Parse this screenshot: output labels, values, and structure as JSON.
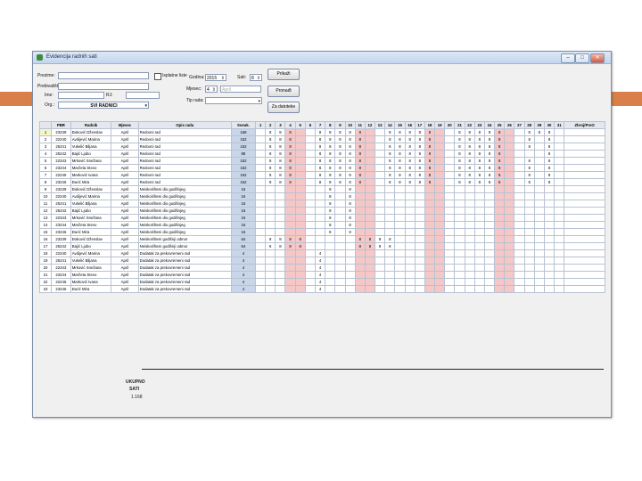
{
  "window": {
    "title": "Evidencija radnih sati",
    "min_label": "–",
    "max_label": "□",
    "close_label": "✕"
  },
  "filters": {
    "prezime_label": "Prezime:",
    "ime_label": "Ime:",
    "prebivaliste_label": "Prebivalište:",
    "radna_jedinica_label": "RJ:",
    "org_label": "Org.:",
    "org_value": "SVI RADNICI",
    "checkbox_label": "Isplatne liste",
    "godina_label": "Godina:",
    "godina_value": "2015",
    "mjesec_label": "Mjesec:",
    "mjesec_value": "4",
    "mjesec_name": "April",
    "sati_label": "Sati:",
    "sati_value": "8",
    "tip_label": "Tip rada:",
    "prikazi_label": "Prikaži",
    "pronadi_label": "Pronađi",
    "za_datoteke_label": "Za datoteke"
  },
  "grid": {
    "headers": [
      "PBR",
      "Radnik",
      "Mjesec",
      "Opis rada",
      "Sveuk.",
      "1",
      "2",
      "3",
      "4",
      "5",
      "6",
      "7",
      "8",
      "9",
      "10",
      "11",
      "12",
      "13",
      "14",
      "15",
      "16",
      "17",
      "18",
      "19",
      "20",
      "21",
      "22",
      "23",
      "24",
      "25",
      "26",
      "27",
      "28",
      "29",
      "30",
      "31",
      "Zbroj/PreO"
    ],
    "weekend_days": [
      4,
      5,
      11,
      12,
      18,
      19,
      25,
      26
    ],
    "rows": [
      {
        "num": "1",
        "pbr": "23239",
        "name": "Đoković Dženslav",
        "month": "April",
        "desc": "Redovni rad",
        "hours": "168",
        "days": [
          "",
          "8",
          "8",
          "8",
          "",
          "",
          "8",
          "8",
          "8",
          "8",
          "8",
          "",
          "",
          "8",
          "8",
          "8",
          "8",
          "8",
          "",
          "",
          "8",
          "8",
          "8",
          "8",
          "8",
          "",
          "",
          "8",
          "8",
          "8",
          ""
        ]
      },
      {
        "num": "2",
        "pbr": "22240",
        "name": "Avdijević Marina",
        "month": "April",
        "desc": "Redovni rad",
        "hours": "152",
        "days": [
          "",
          "8",
          "8",
          "8",
          "",
          "",
          "8",
          "8",
          "8",
          "8",
          "8",
          "",
          "",
          "8",
          "8",
          "8",
          "8",
          "8",
          "",
          "",
          "8",
          "8",
          "8",
          "8",
          "8",
          "",
          "",
          "8",
          "",
          "8",
          ""
        ]
      },
      {
        "num": "3",
        "pbr": "25241",
        "name": "Vukelić Biljana",
        "month": "April",
        "desc": "Redovni rad",
        "hours": "152",
        "days": [
          "",
          "8",
          "8",
          "8",
          "",
          "",
          "8",
          "8",
          "8",
          "8",
          "8",
          "",
          "",
          "8",
          "8",
          "8",
          "8",
          "8",
          "",
          "",
          "8",
          "8",
          "8",
          "8",
          "8",
          "",
          "",
          "8",
          "",
          "8",
          ""
        ]
      },
      {
        "num": "4",
        "pbr": "25242",
        "name": "Bajić Ljubo",
        "month": "April",
        "desc": "Redovni rad",
        "hours": "88",
        "days": [
          "",
          "8",
          "8",
          "8",
          "",
          "",
          "8",
          "8",
          "8",
          "8",
          "8",
          "",
          "",
          "8",
          "8",
          "8",
          "8",
          "8",
          "",
          "",
          "8",
          "8",
          "8",
          "8",
          "8",
          "",
          "",
          "",
          "",
          "8",
          ""
        ]
      },
      {
        "num": "5",
        "pbr": "22343",
        "name": "Mrković Snežana",
        "month": "April",
        "desc": "Redovni rad",
        "hours": "152",
        "days": [
          "",
          "8",
          "8",
          "8",
          "",
          "",
          "8",
          "8",
          "8",
          "8",
          "8",
          "",
          "",
          "8",
          "8",
          "8",
          "8",
          "8",
          "",
          "",
          "8",
          "8",
          "8",
          "8",
          "8",
          "",
          "",
          "8",
          "",
          "8",
          ""
        ]
      },
      {
        "num": "6",
        "pbr": "23244",
        "name": "Marčeta Stevo",
        "month": "April",
        "desc": "Redovni rad",
        "hours": "152",
        "days": [
          "",
          "8",
          "8",
          "8",
          "",
          "",
          "8",
          "8",
          "8",
          "8",
          "8",
          "",
          "",
          "8",
          "8",
          "8",
          "8",
          "8",
          "",
          "",
          "8",
          "8",
          "8",
          "8",
          "8",
          "",
          "",
          "8",
          "",
          "8",
          ""
        ]
      },
      {
        "num": "7",
        "pbr": "22245",
        "name": "Marković Ivana",
        "month": "April",
        "desc": "Redovni rad",
        "hours": "152",
        "days": [
          "",
          "8",
          "8",
          "8",
          "",
          "",
          "8",
          "8",
          "8",
          "8",
          "8",
          "",
          "",
          "8",
          "8",
          "8",
          "8",
          "8",
          "",
          "",
          "8",
          "8",
          "8",
          "8",
          "8",
          "",
          "",
          "8",
          "",
          "8",
          ""
        ]
      },
      {
        "num": "8",
        "pbr": "23246",
        "name": "Đurić Mira",
        "month": "April",
        "desc": "Redovni rad",
        "hours": "152",
        "days": [
          "",
          "8",
          "8",
          "8",
          "",
          "",
          "8",
          "8",
          "8",
          "8",
          "8",
          "",
          "",
          "8",
          "8",
          "8",
          "8",
          "8",
          "",
          "",
          "8",
          "8",
          "8",
          "8",
          "8",
          "",
          "",
          "8",
          "",
          "8",
          ""
        ]
      },
      {
        "num": "9",
        "pbr": "23239",
        "name": "Đoković Dženslav",
        "month": "April",
        "desc": "Neiskorišteni dio godišnjeg",
        "hours": "16",
        "days": [
          "",
          "",
          "",
          "",
          "",
          "",
          "",
          "8",
          "",
          "8",
          "",
          "",
          "",
          "",
          "",
          "",
          "",
          "",
          "",
          "",
          "",
          "",
          "",
          "",
          "",
          "",
          "",
          "",
          "",
          "",
          ""
        ]
      },
      {
        "num": "10",
        "pbr": "22240",
        "name": "Avdijević Marina",
        "month": "April",
        "desc": "Neiskorišteni dio godišnjeg",
        "hours": "16",
        "days": [
          "",
          "",
          "",
          "",
          "",
          "",
          "",
          "8",
          "",
          "8",
          "",
          "",
          "",
          "",
          "",
          "",
          "",
          "",
          "",
          "",
          "",
          "",
          "",
          "",
          "",
          "",
          "",
          "",
          "",
          "",
          ""
        ]
      },
      {
        "num": "11",
        "pbr": "25241",
        "name": "Vukelić Biljana",
        "month": "April",
        "desc": "Neiskorišteni dio godišnjeg",
        "hours": "16",
        "days": [
          "",
          "",
          "",
          "",
          "",
          "",
          "",
          "8",
          "",
          "8",
          "",
          "",
          "",
          "",
          "",
          "",
          "",
          "",
          "",
          "",
          "",
          "",
          "",
          "",
          "",
          "",
          "",
          "",
          "",
          "",
          ""
        ]
      },
      {
        "num": "12",
        "pbr": "25242",
        "name": "Bajić Ljubo",
        "month": "April",
        "desc": "Neiskorišteni dio godišnjeg",
        "hours": "16",
        "days": [
          "",
          "",
          "",
          "",
          "",
          "",
          "",
          "8",
          "",
          "8",
          "",
          "",
          "",
          "",
          "",
          "",
          "",
          "",
          "",
          "",
          "",
          "",
          "",
          "",
          "",
          "",
          "",
          "",
          "",
          "",
          ""
        ]
      },
      {
        "num": "13",
        "pbr": "22343",
        "name": "Mrković Snežana",
        "month": "April",
        "desc": "Neiskorišteni dio godišnjeg",
        "hours": "16",
        "days": [
          "",
          "",
          "",
          "",
          "",
          "",
          "",
          "8",
          "",
          "8",
          "",
          "",
          "",
          "",
          "",
          "",
          "",
          "",
          "",
          "",
          "",
          "",
          "",
          "",
          "",
          "",
          "",
          "",
          "",
          "",
          ""
        ]
      },
      {
        "num": "14",
        "pbr": "23244",
        "name": "Marčeta Stevo",
        "month": "April",
        "desc": "Neiskorišteni dio godišnjeg",
        "hours": "16",
        "days": [
          "",
          "",
          "",
          "",
          "",
          "",
          "",
          "8",
          "",
          "8",
          "",
          "",
          "",
          "",
          "",
          "",
          "",
          "",
          "",
          "",
          "",
          "",
          "",
          "",
          "",
          "",
          "",
          "",
          "",
          "",
          ""
        ]
      },
      {
        "num": "15",
        "pbr": "23246",
        "name": "Đurić Mira",
        "month": "April",
        "desc": "Neiskorišteni dio godišnjeg",
        "hours": "16",
        "days": [
          "",
          "",
          "",
          "",
          "",
          "",
          "",
          "8",
          "",
          "8",
          "",
          "",
          "",
          "",
          "",
          "",
          "",
          "",
          "",
          "",
          "",
          "",
          "",
          "",
          "",
          "",
          "",
          "",
          "",
          "",
          ""
        ]
      },
      {
        "num": "16",
        "pbr": "23239",
        "name": "Đoković Dženslav",
        "month": "April",
        "desc": "Neiskorišteni godišnji odmor",
        "hours": "64",
        "days": [
          "",
          "8",
          "8",
          "8",
          "8",
          "",
          "",
          "",
          "",
          "",
          "8",
          "8",
          "8",
          "8",
          "",
          "",
          "",
          "",
          "",
          "",
          "",
          "",
          "",
          "",
          "",
          "",
          "",
          "",
          "",
          "",
          ""
        ]
      },
      {
        "num": "17",
        "pbr": "25242",
        "name": "Bajić Ljubo",
        "month": "April",
        "desc": "Neiskorišteni godišnji odmor",
        "hours": "64",
        "days": [
          "",
          "8",
          "8",
          "8",
          "8",
          "",
          "",
          "",
          "",
          "",
          "8",
          "8",
          "8",
          "8",
          "",
          "",
          "",
          "",
          "",
          "",
          "",
          "",
          "",
          "",
          "",
          "",
          "",
          "",
          "",
          "",
          ""
        ]
      },
      {
        "num": "18",
        "pbr": "22240",
        "name": "Avdijević Marina",
        "month": "April",
        "desc": "Dodatak za prekovremeni rad",
        "hours": "4",
        "days": [
          "",
          "",
          "",
          "",
          "",
          "",
          "4",
          "",
          "",
          "",
          "",
          "",
          "",
          "",
          "",
          "",
          "",
          "",
          "",
          "",
          "",
          "",
          "",
          "",
          "",
          "",
          "",
          "",
          "",
          "",
          ""
        ]
      },
      {
        "num": "19",
        "pbr": "25241",
        "name": "Vukelić Biljana",
        "month": "April",
        "desc": "Dodatak za prekovremeni rad",
        "hours": "4",
        "days": [
          "",
          "",
          "",
          "",
          "",
          "",
          "4",
          "",
          "",
          "",
          "",
          "",
          "",
          "",
          "",
          "",
          "",
          "",
          "",
          "",
          "",
          "",
          "",
          "",
          "",
          "",
          "",
          "",
          "",
          "",
          ""
        ]
      },
      {
        "num": "20",
        "pbr": "22343",
        "name": "Mrković Snežana",
        "month": "April",
        "desc": "Dodatak za prekovremeni rad",
        "hours": "4",
        "days": [
          "",
          "",
          "",
          "",
          "",
          "",
          "4",
          "",
          "",
          "",
          "",
          "",
          "",
          "",
          "",
          "",
          "",
          "",
          "",
          "",
          "",
          "",
          "",
          "",
          "",
          "",
          "",
          "",
          "",
          "",
          ""
        ]
      },
      {
        "num": "21",
        "pbr": "23244",
        "name": "Marčeta Stevo",
        "month": "April",
        "desc": "Dodatak za prekovremeni rad",
        "hours": "4",
        "days": [
          "",
          "",
          "",
          "",
          "",
          "",
          "4",
          "",
          "",
          "",
          "",
          "",
          "",
          "",
          "",
          "",
          "",
          "",
          "",
          "",
          "",
          "",
          "",
          "",
          "",
          "",
          "",
          "",
          "",
          "",
          ""
        ]
      },
      {
        "num": "22",
        "pbr": "22245",
        "name": "Marković Ivana",
        "month": "April",
        "desc": "Dodatak za prekovremeni rad",
        "hours": "4",
        "days": [
          "",
          "",
          "",
          "",
          "",
          "",
          "4",
          "",
          "",
          "",
          "",
          "",
          "",
          "",
          "",
          "",
          "",
          "",
          "",
          "",
          "",
          "",
          "",
          "",
          "",
          "",
          "",
          "",
          "",
          "",
          ""
        ]
      },
      {
        "num": "23",
        "pbr": "23246",
        "name": "Đurić Mira",
        "month": "April",
        "desc": "Dodatak za prekovremeni rad",
        "hours": "4",
        "days": [
          "",
          "",
          "",
          "",
          "",
          "",
          "4",
          "",
          "",
          "",
          "",
          "",
          "",
          "",
          "",
          "",
          "",
          "",
          "",
          "",
          "",
          "",
          "",
          "",
          "",
          "",
          "",
          "",
          "",
          "",
          ""
        ]
      }
    ]
  },
  "summary": {
    "ukupno_label": "UKUPNO",
    "sati_label": "SATI",
    "total_label": "1.168"
  }
}
